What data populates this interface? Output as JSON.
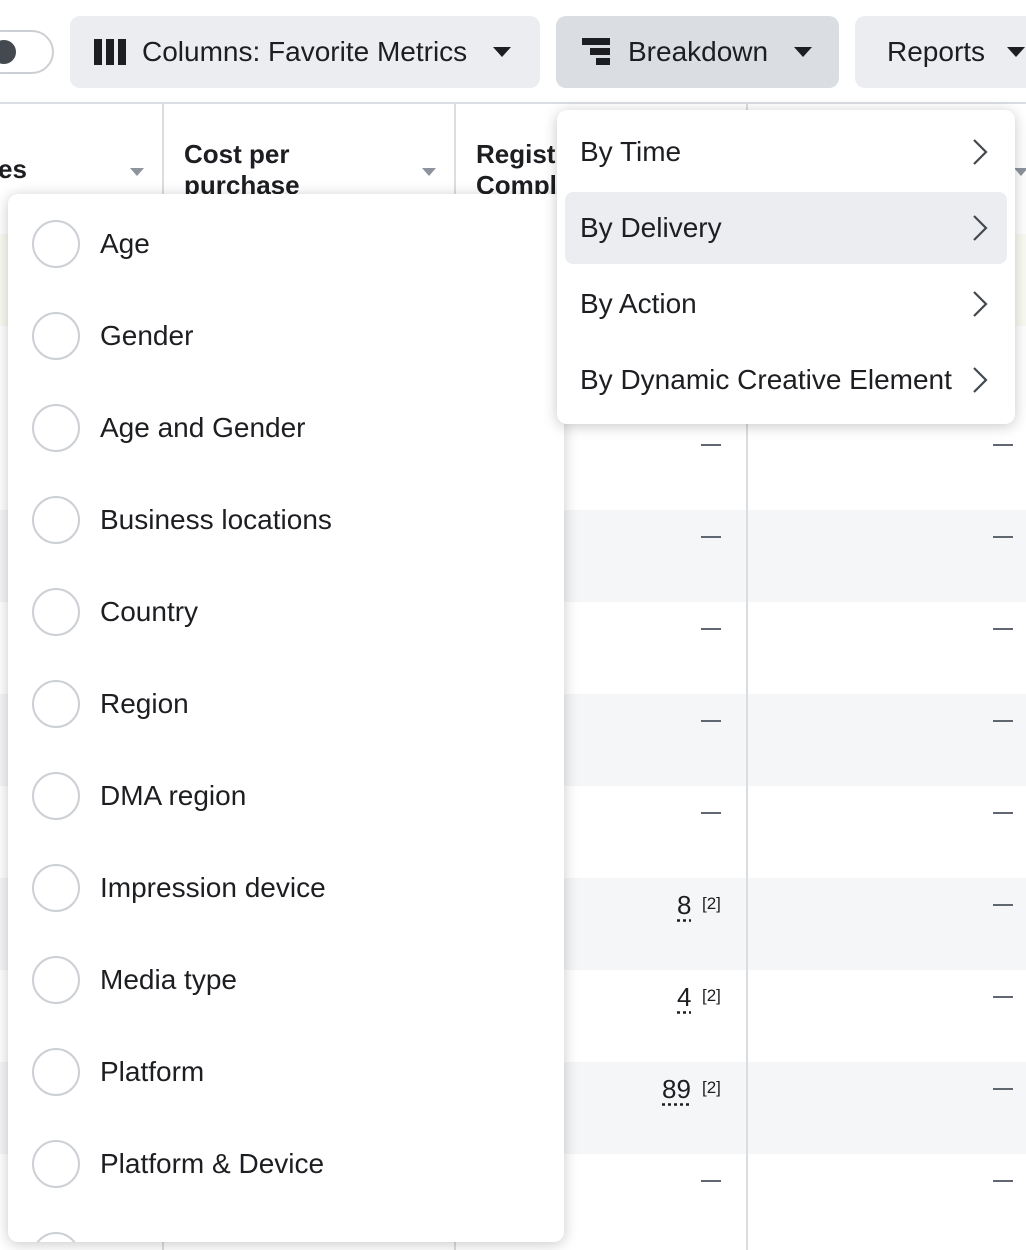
{
  "toolbar": {
    "columns_label": "Columns: Favorite Metrics",
    "breakdown_label": "Breakdown",
    "reports_label": "Reports"
  },
  "table": {
    "headers": [
      {
        "text": "es"
      },
      {
        "text": "Cost per purchase"
      },
      {
        "text": "Regist Compl"
      }
    ],
    "rows": [
      {
        "col3": "—",
        "col4": "—"
      },
      {
        "col3": "—",
        "col4": "—"
      },
      {
        "col3": "—",
        "col4": "—"
      },
      {
        "col3": "—",
        "col4": "—"
      },
      {
        "col3": "—",
        "col4": "—"
      },
      {
        "col3": "8",
        "col3_note": "[2]",
        "col4": "—"
      },
      {
        "col3": "4",
        "col3_note": "[2]",
        "col4": "—"
      },
      {
        "col3": "89",
        "col3_note": "[2]",
        "col4": "—"
      },
      {
        "col3": "—",
        "col4": "—"
      }
    ]
  },
  "breakdown_menu": {
    "items": [
      {
        "label": "By Time"
      },
      {
        "label": "By Delivery"
      },
      {
        "label": "By Action"
      },
      {
        "label": "By Dynamic Creative Element"
      }
    ]
  },
  "delivery_options": {
    "items": [
      {
        "label": "Age"
      },
      {
        "label": "Gender"
      },
      {
        "label": "Age and Gender"
      },
      {
        "label": "Business locations"
      },
      {
        "label": "Country"
      },
      {
        "label": "Region"
      },
      {
        "label": "DMA region"
      },
      {
        "label": "Impression device"
      },
      {
        "label": "Media type"
      },
      {
        "label": "Platform"
      },
      {
        "label": "Platform & Device"
      }
    ]
  },
  "colors": {
    "button_bg": "#ebedf0",
    "button_active_bg": "#dadde1",
    "border": "#dadde1",
    "text": "#1c1e21",
    "alt_row": "#f5f6f7"
  }
}
